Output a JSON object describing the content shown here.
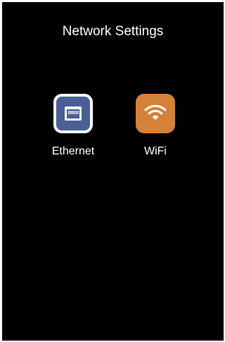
{
  "header": {
    "title": "Network Settings"
  },
  "options": [
    {
      "label": "Ethernet",
      "icon": "ethernet-port-icon",
      "color": "#4a5f96",
      "selected": true
    },
    {
      "label": "WiFi",
      "icon": "wifi-icon",
      "color": "#d4813a",
      "selected": false
    }
  ],
  "theme": {
    "background": "#000000",
    "text": "#ffffff"
  }
}
